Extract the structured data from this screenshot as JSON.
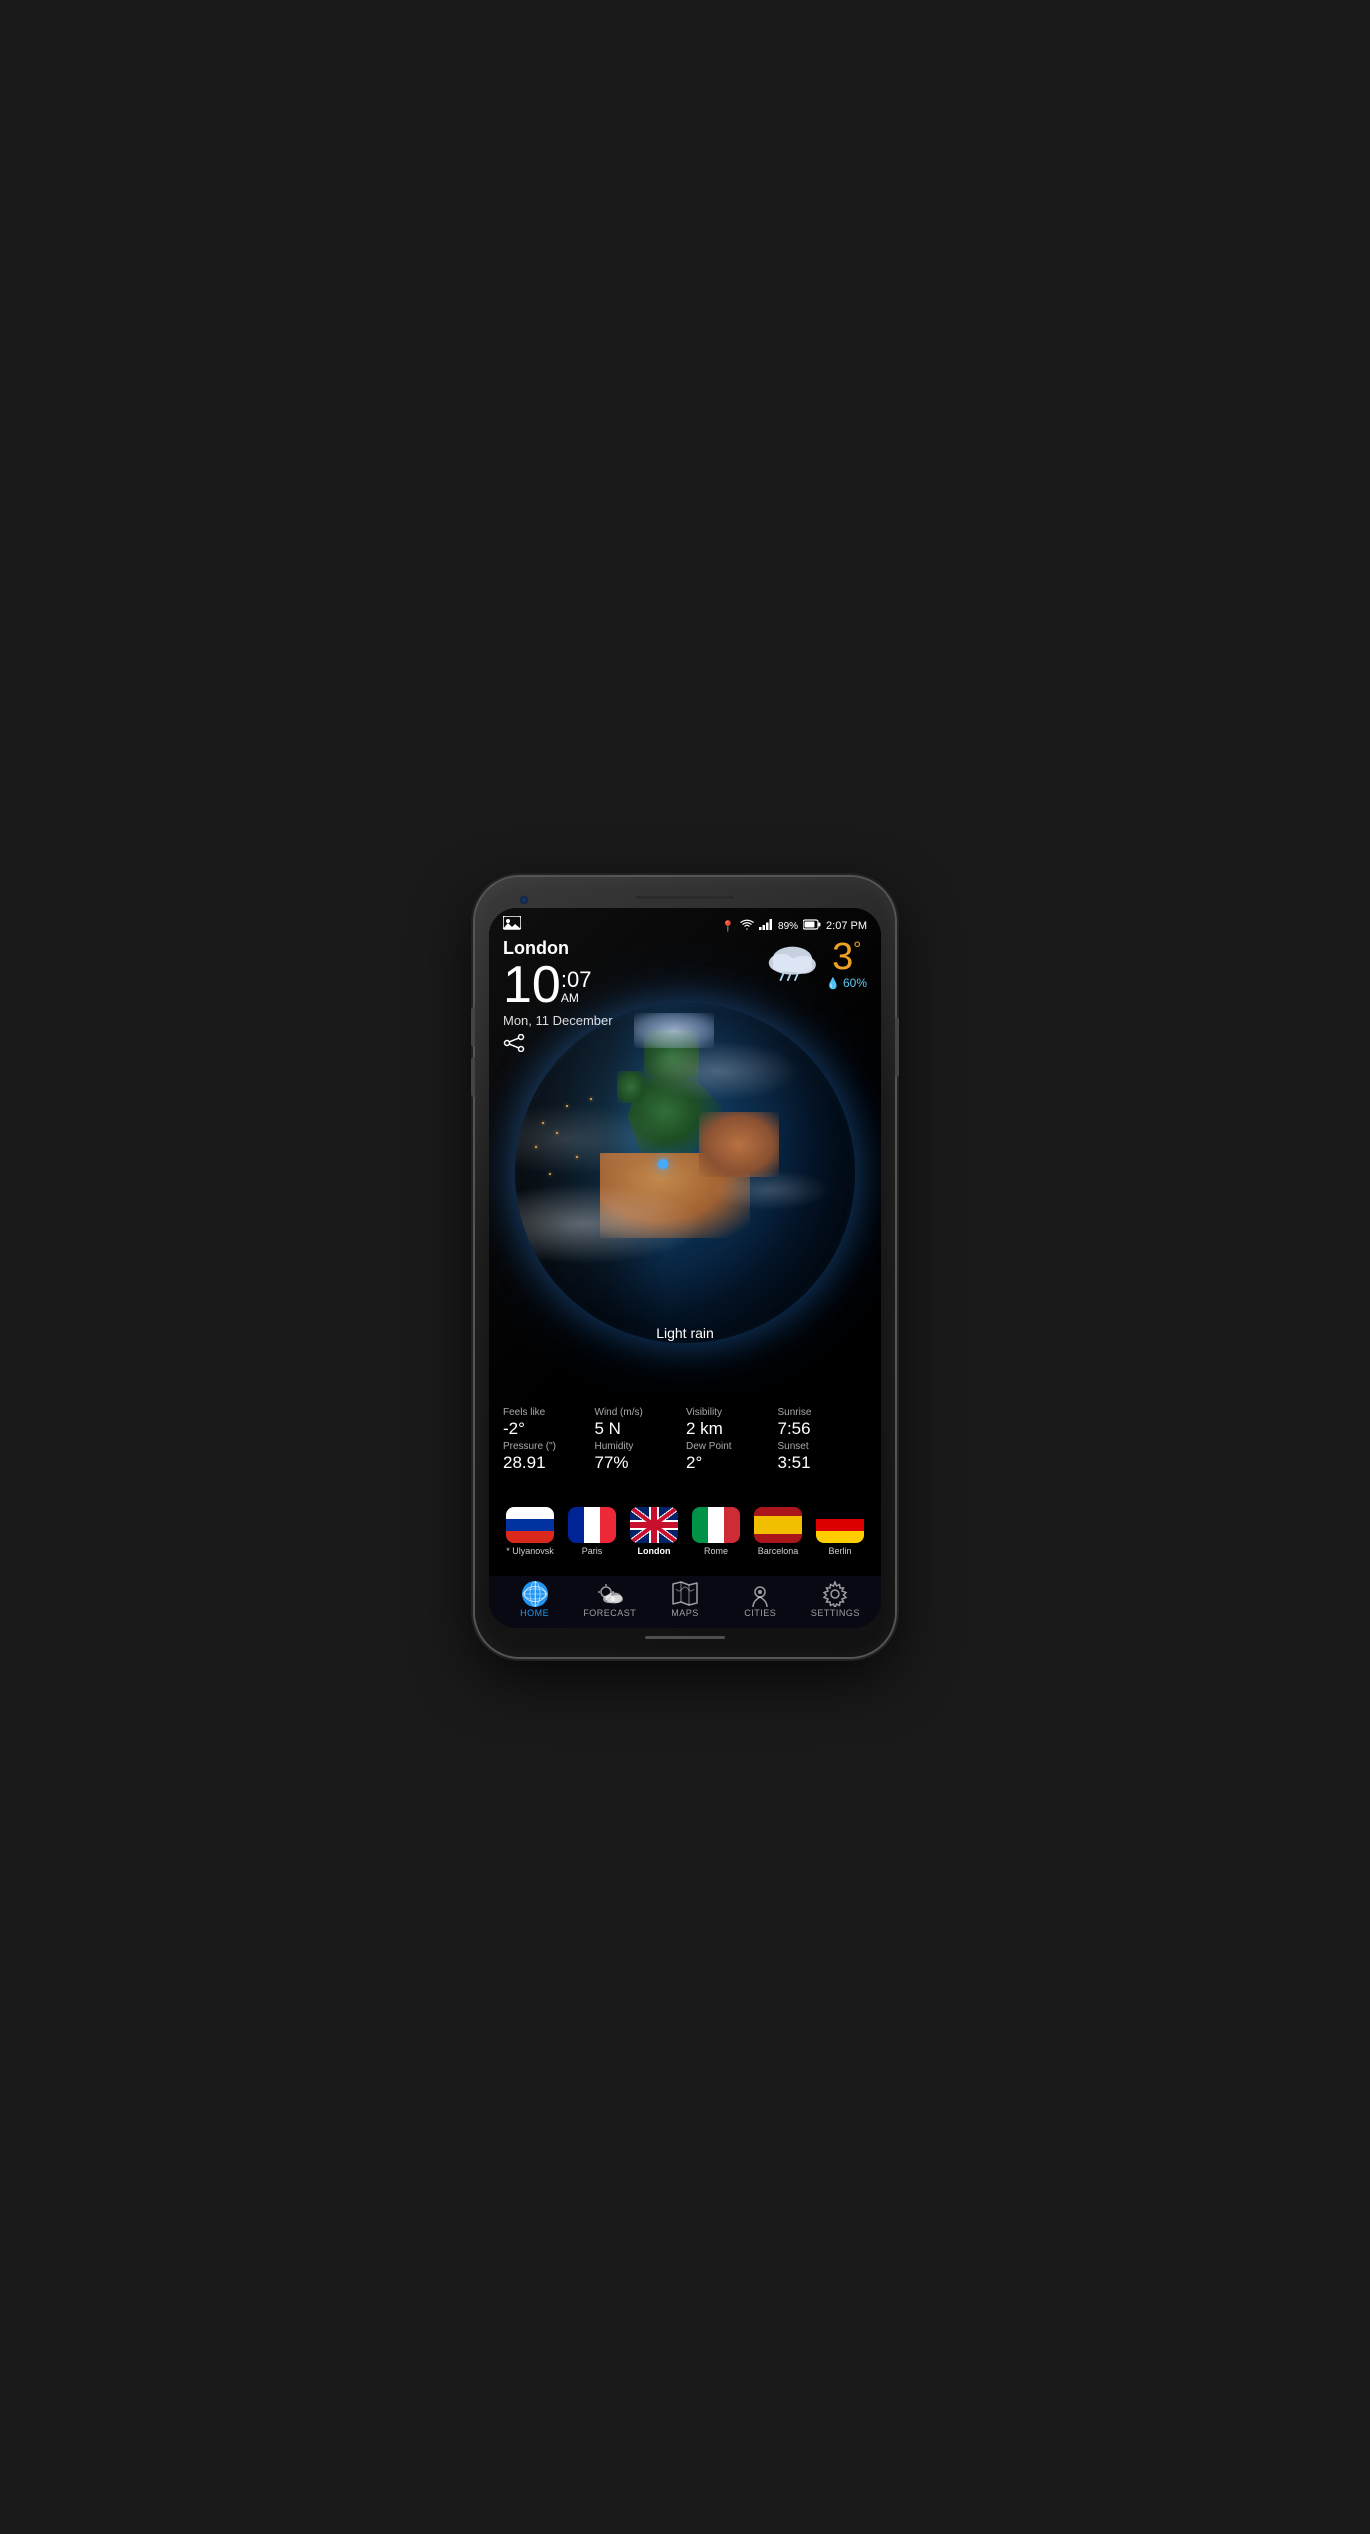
{
  "phone": {
    "status_bar": {
      "left_icon": "photo",
      "location_icon": "📍",
      "wifi": "wifi",
      "signal": "signal",
      "battery": "89%",
      "time": "2:07 PM"
    },
    "city": "London",
    "time_hour": "10",
    "time_minutes": ":07",
    "time_ampm": "AM",
    "date": "Mon, 11 December",
    "weather": {
      "condition": "Light rain",
      "temperature": "3",
      "temp_unit": "°",
      "precipitation": "60%",
      "feels_like_label": "Feels like",
      "feels_like_value": "-2°",
      "wind_label": "Wind (m/s)",
      "wind_value": "5 N",
      "visibility_label": "Visibility",
      "visibility_value": "2 km",
      "sunrise_label": "Sunrise",
      "sunrise_value": "7:56",
      "pressure_label": "Pressure (\")",
      "pressure_value": "28.91",
      "humidity_label": "Humidity",
      "humidity_value": "77%",
      "dew_point_label": "Dew Point",
      "dew_point_value": "2°",
      "sunset_label": "Sunset",
      "sunset_value": "3:51"
    },
    "cities": [
      {
        "name": "* Ulyanovsk",
        "flag": "russia",
        "active": false
      },
      {
        "name": "Paris",
        "flag": "france",
        "active": false
      },
      {
        "name": "London",
        "flag": "uk",
        "active": true
      },
      {
        "name": "Rome",
        "flag": "italy",
        "active": false
      },
      {
        "name": "Barcelona",
        "flag": "spain",
        "active": false
      },
      {
        "name": "Berlin",
        "flag": "germany",
        "active": false
      }
    ],
    "nav": [
      {
        "id": "home",
        "label": "HOME",
        "active": true
      },
      {
        "id": "forecast",
        "label": "FORECAST",
        "active": false
      },
      {
        "id": "maps",
        "label": "MAPS",
        "active": false
      },
      {
        "id": "cities",
        "label": "CITIES",
        "active": false
      },
      {
        "id": "settings",
        "label": "SETTINGS",
        "active": false
      }
    ]
  }
}
